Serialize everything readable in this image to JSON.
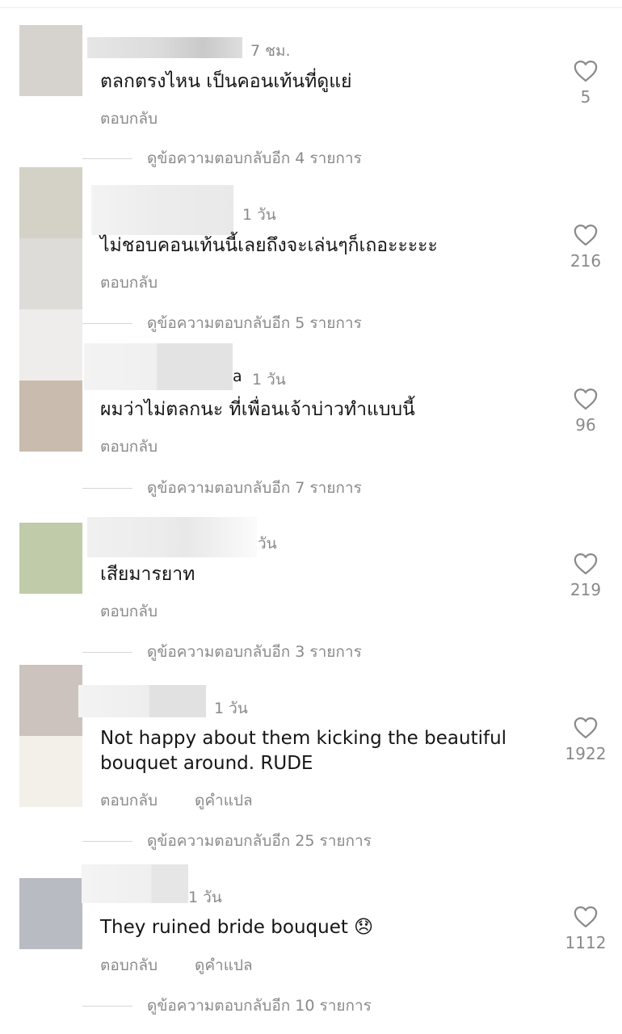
{
  "comments": [
    {
      "time": "7 ชม.",
      "text": "ตลกตรงไหน เป็นคอนเท้นที่ดูแย่",
      "reply": "ตอบกลับ",
      "likes": "5",
      "view_more": "ดูข้อความตอบกลับอีก 4 รายการ"
    },
    {
      "time": "1 วัน",
      "text": "ไม่ชอบคอนเท้นนี้เลยถึงจะเล่นๆก็เถอะะะะะ",
      "reply": "ตอบกลับ",
      "likes": "216",
      "view_more": "ดูข้อความตอบกลับอีก 5 รายการ"
    },
    {
      "name_fragment": "a",
      "time": "1 วัน",
      "text": "ผมว่าไม่ตลกนะ ที่เพื่อนเจ้าบ่าวทำแบบนี้",
      "reply": "ตอบกลับ",
      "likes": "96",
      "view_more": "ดูข้อความตอบกลับอีก 7 รายการ"
    },
    {
      "time": "วัน",
      "text": "เสียมารยาท",
      "reply": "ตอบกลับ",
      "likes": "219",
      "view_more": "ดูข้อความตอบกลับอีก 3 รายการ"
    },
    {
      "time": "1 วัน",
      "text": "Not happy about them kicking the beautiful bouquet around.  RUDE",
      "reply": "ตอบกลับ",
      "translate": "ดูคำแปล",
      "likes": "1922",
      "view_more": "ดูข้อความตอบกลับอีก 25 รายการ"
    },
    {
      "time": "1 วัน",
      "text": "They ruined bride bouquet 😞",
      "reply": "ตอบกลับ",
      "translate": "ดูคำแปล",
      "likes": "1112",
      "view_more": "ดูข้อความตอบกลับอีก 10 รายการ"
    }
  ],
  "colors": {
    "avatar_1": "#d6d2ce",
    "avatar_2a": "#d4d1c6",
    "avatar_2b": "#dedcd9",
    "avatar_3a": "#efedec",
    "avatar_3b": "#c9bcaf",
    "avatar_4": "#c0cba9",
    "avatar_5a": "#ccc3bf",
    "avatar_5b": "#f3efe9",
    "avatar_6": "#b8bcc2",
    "secondary_text": "#8a8a8a",
    "primary_text": "#161616"
  },
  "icons": {
    "like": "heart-outline-icon"
  }
}
